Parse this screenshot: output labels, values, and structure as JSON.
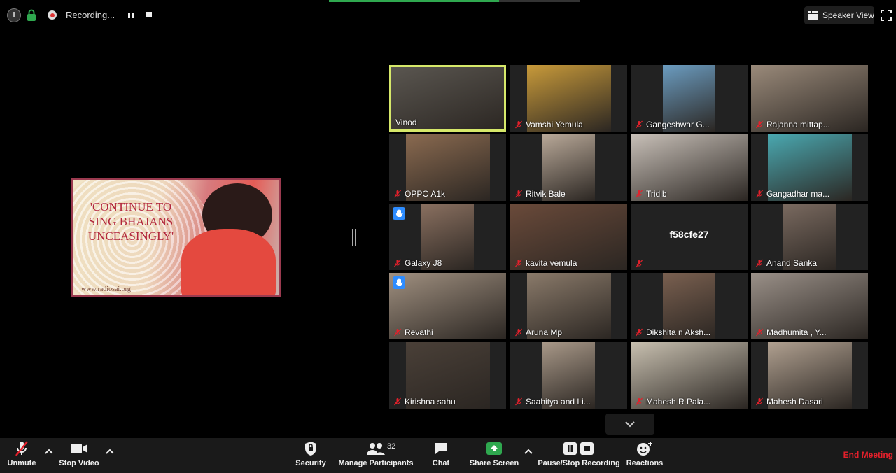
{
  "topbar": {
    "recording_label": "Recording...",
    "speaker_view_label": "Speaker View"
  },
  "shared_content": {
    "quote": "'CONTINUE TO SING BHAJANS UNCEASINGLY'",
    "watermark": "www.radiosai.org"
  },
  "participants": [
    {
      "name": "Vinod",
      "muted": false,
      "active": true,
      "hand": false,
      "bg": "#5a5650"
    },
    {
      "name": "Vamshi Yemula",
      "muted": true,
      "active": false,
      "hand": false,
      "bg": "#c89a3a"
    },
    {
      "name": "Gangeshwar G...",
      "muted": true,
      "active": false,
      "hand": false,
      "bg": "#6b9cc0"
    },
    {
      "name": "Rajanna mittap...",
      "muted": true,
      "active": false,
      "hand": false,
      "bg": "#9a8a7a"
    },
    {
      "name": "OPPO A1k",
      "muted": true,
      "active": false,
      "hand": false,
      "bg": "#8a6a50"
    },
    {
      "name": "Ritvik Bale",
      "muted": true,
      "active": false,
      "hand": false,
      "bg": "#b8a898"
    },
    {
      "name": "Tridib",
      "muted": true,
      "active": false,
      "hand": false,
      "bg": "#c8c0b8"
    },
    {
      "name": "Gangadhar ma...",
      "muted": true,
      "active": false,
      "hand": false,
      "bg": "#4aa8b0"
    },
    {
      "name": "Galaxy J8",
      "muted": true,
      "active": false,
      "hand": true,
      "bg": "#8a7060"
    },
    {
      "name": "kavita vemula",
      "muted": true,
      "active": false,
      "hand": false,
      "bg": "#6a4a3a"
    },
    {
      "name": "f58cfe27",
      "muted": true,
      "active": false,
      "hand": false,
      "bg": "#222222",
      "no_video": true
    },
    {
      "name": "Anand Sanka",
      "muted": true,
      "active": false,
      "hand": false,
      "bg": "#7a6a60"
    },
    {
      "name": "Revathi",
      "muted": true,
      "active": false,
      "hand": true,
      "bg": "#a09080"
    },
    {
      "name": "Aruna Mp",
      "muted": true,
      "active": false,
      "hand": false,
      "bg": "#8a7a6a"
    },
    {
      "name": "Dikshita n Aksh...",
      "muted": true,
      "active": false,
      "hand": false,
      "bg": "#7a6050"
    },
    {
      "name": "Madhumita , Y...",
      "muted": true,
      "active": false,
      "hand": false,
      "bg": "#9a9088"
    },
    {
      "name": "Kirishna sahu",
      "muted": true,
      "active": false,
      "hand": false,
      "bg": "#4a4038"
    },
    {
      "name": "Saahitya and Li...",
      "muted": true,
      "active": false,
      "hand": false,
      "bg": "#a89888"
    },
    {
      "name": "Mahesh R Pala...",
      "muted": true,
      "active": false,
      "hand": false,
      "bg": "#c8c0b0"
    },
    {
      "name": "Mahesh Dasari",
      "muted": true,
      "active": false,
      "hand": false,
      "bg": "#b0a090"
    }
  ],
  "toolbar": {
    "unmute": "Unmute",
    "stop_video": "Stop Video",
    "security": "Security",
    "manage_participants": "Manage Participants",
    "participant_count": "32",
    "chat": "Chat",
    "share_screen": "Share Screen",
    "pause_stop_recording": "Pause/Stop Recording",
    "reactions": "Reactions",
    "end_meeting": "End Meeting"
  },
  "colors": {
    "active_speaker_border": "#d6e86a",
    "end_meeting": "#e5202b",
    "share_screen_green": "#2fa84f",
    "raise_hand_blue": "#2d8cff",
    "muted_red": "#e5202b"
  }
}
